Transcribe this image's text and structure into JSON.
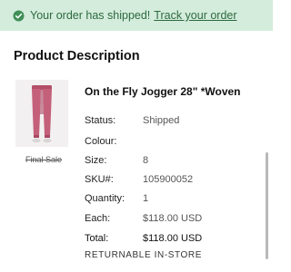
{
  "banner": {
    "message": "Your order has shipped!",
    "link_text": "Track your order",
    "icon": "check-circle-icon",
    "background": "#d4ecdc",
    "text_color": "#2c6a3f"
  },
  "section": {
    "title": "Product Description"
  },
  "product": {
    "name": "On the Fly Jogger 28\" *Woven",
    "final_sale": "Final Sale",
    "details": [
      {
        "label": "Status:",
        "value": "Shipped"
      },
      {
        "label": "Colour:",
        "value": ""
      },
      {
        "label": "Size:",
        "value": "8"
      },
      {
        "label": "SKU#:",
        "value": "105900052"
      },
      {
        "label": "Quantity:",
        "value": "1"
      },
      {
        "label": "Each:",
        "value": "$118.00 USD"
      }
    ],
    "total_label": "Total:",
    "total_value": "$118.00 USD",
    "returnable": "RETURNABLE IN-STORE",
    "pants_color": "#c4607a"
  }
}
